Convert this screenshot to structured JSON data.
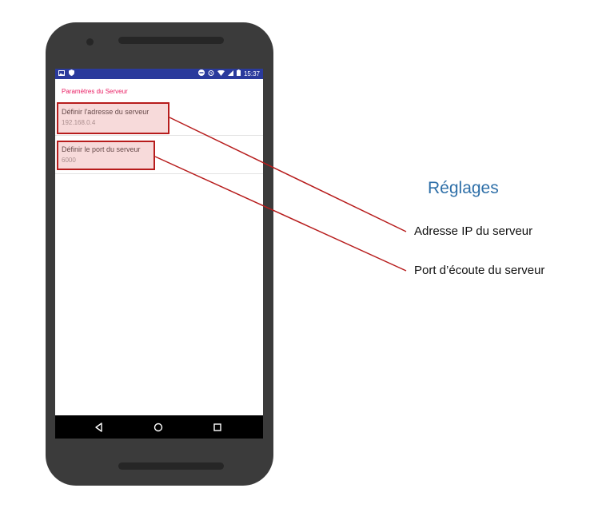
{
  "status_bar": {
    "time": "15:37",
    "left_icons": [
      "image-icon",
      "shield-icon"
    ],
    "right_icons": [
      "minus-circle-icon",
      "alarm-icon",
      "wifi-icon",
      "signal-icon",
      "battery-icon"
    ]
  },
  "settings": {
    "section_title": "Paramètres du Serveur",
    "items": [
      {
        "title": "Définir l'adresse du serveur",
        "summary": "192.168.0.4"
      },
      {
        "title": "Définir le port du serveur",
        "summary": "6000"
      }
    ]
  },
  "nav_bar": {
    "buttons": [
      "back-icon",
      "home-icon",
      "recents-icon"
    ]
  },
  "annotations": {
    "title": "Réglages",
    "labels": [
      "Adresse IP du serveur",
      "Port d’écoute du serveur"
    ]
  },
  "colors": {
    "status_bar": "#2a3a9c",
    "section_title": "#e91e63",
    "highlight_border": "#b71c1c",
    "annotation_title": "#2e6fa8",
    "phone_body": "#3b3b3b"
  }
}
